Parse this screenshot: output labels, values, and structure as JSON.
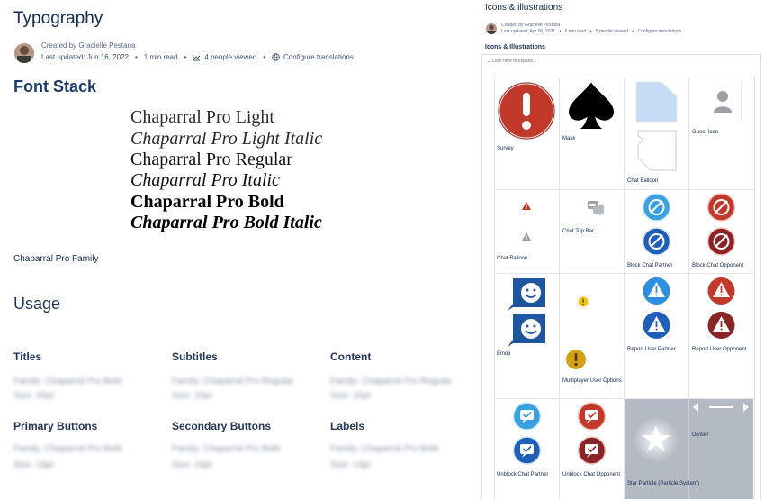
{
  "left": {
    "title": "Typography",
    "created_by": "Created by Gracielle Pestana",
    "last_updated": "Last updated: Jun 16, 2022",
    "read_time": "1 min read",
    "viewed": "4 people viewed",
    "configure": "Configure translations",
    "font_stack_heading": "Font Stack",
    "font_samples": [
      "Chaparral Pro Light",
      "Chaparral Pro Light Italic",
      "Chaparral Pro Regular",
      "Chaparral Pro Italic",
      "Chaparral Pro Bold",
      "Chaparral Pro Bold Italic"
    ],
    "family_caption": "Chaparral Pro Family",
    "usage_heading": "Usage",
    "usage": [
      {
        "title": "Titles",
        "line1": "Family: Chaparral Pro Bold",
        "line2": "Size: 30pt"
      },
      {
        "title": "Subtitles",
        "line1": "Family: Chaparral Pro Regular",
        "line2": "Size: 20pt"
      },
      {
        "title": "Content",
        "line1": "Family: Chaparral Pro Regular",
        "line2": "Size: 16pt"
      },
      {
        "title": "Primary Buttons",
        "line1": "Family: Chaparral Pro Bold",
        "line2": "Size: 18pt"
      },
      {
        "title": "Secondary Buttons",
        "line1": "Family: Chaparral Pro Bold",
        "line2": "Size: 16pt"
      },
      {
        "title": "Labels",
        "line1": "Family: Chaparral Pro Bold",
        "line2": "Size: 14pt"
      }
    ]
  },
  "right": {
    "title": "Icons & illustrations",
    "created_by": "Created by Gracielle Pestana",
    "last_updated": "Last updated: Apr 06, 2021",
    "read_time": "6 min read",
    "viewed": "5 people viewed",
    "configure": "Configure translations",
    "section": "Icons & Illustrations",
    "expand": "Click here to expand...",
    "cells": [
      {
        "label": "Survey"
      },
      {
        "label": "Mask"
      },
      {
        "label": "Chat Balloon"
      },
      {
        "label": "Guest Icon"
      },
      {
        "label": "Chat Balloon"
      },
      {
        "label": "Chat Top Bar"
      },
      {
        "label": "Block Chat Partner"
      },
      {
        "label": "Block Chat Opponent"
      },
      {
        "label": "Emoji"
      },
      {
        "label": "Multiplayer User Options"
      },
      {
        "label": "Report User Partner"
      },
      {
        "label": "Report User Opponent"
      },
      {
        "label": "Unblock Chat Partner"
      },
      {
        "label": "Unblock Chat Opponent"
      },
      {
        "label": "Star Particle (Particle System)"
      },
      {
        "label": "Diviser"
      }
    ]
  },
  "colors": {
    "red": "#b93636",
    "blue": "#2f74c9",
    "lightblue": "#3a9be0",
    "darkblue": "#1d4fa1",
    "darkred": "#8b2426",
    "yellow": "#f1c40f",
    "greybg": "#b4bac4"
  }
}
